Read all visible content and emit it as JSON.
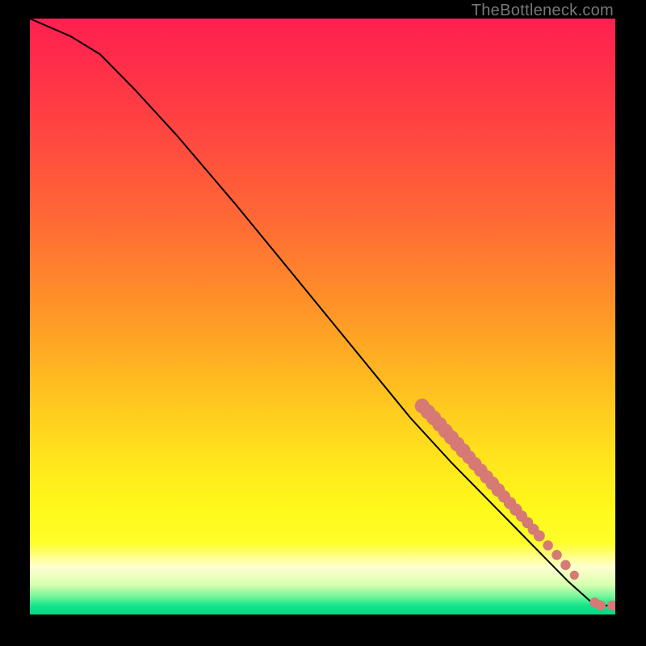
{
  "watermark": "TheBottleneck.com",
  "colors": {
    "marker": "#d77a76",
    "curve": "#000000"
  },
  "chart_data": {
    "type": "line",
    "title": "",
    "xlabel": "",
    "ylabel": "",
    "xlim": [
      0,
      100
    ],
    "ylim": [
      0,
      100
    ],
    "grid": false,
    "gradient": {
      "top": "#ff2050",
      "bottom": "#00d884",
      "description": "red→orange→yellow→pale→green vertical gradient"
    },
    "curve": [
      {
        "x": 0,
        "y": 100
      },
      {
        "x": 7,
        "y": 97
      },
      {
        "x": 12,
        "y": 94
      },
      {
        "x": 18,
        "y": 88
      },
      {
        "x": 25,
        "y": 80.5
      },
      {
        "x": 35,
        "y": 69
      },
      {
        "x": 45,
        "y": 57
      },
      {
        "x": 55,
        "y": 45
      },
      {
        "x": 65,
        "y": 33
      },
      {
        "x": 72,
        "y": 25.5
      },
      {
        "x": 78,
        "y": 19.5
      },
      {
        "x": 83,
        "y": 14.5
      },
      {
        "x": 88,
        "y": 9.5
      },
      {
        "x": 92,
        "y": 5.5
      },
      {
        "x": 96,
        "y": 2.0
      },
      {
        "x": 97.5,
        "y": 1.5
      },
      {
        "x": 99.5,
        "y": 1.5
      }
    ],
    "markers": [
      {
        "x": 67,
        "y": 35.0,
        "r": 1.3
      },
      {
        "x": 68,
        "y": 34.0,
        "r": 1.3
      },
      {
        "x": 69,
        "y": 33.0,
        "r": 1.3
      },
      {
        "x": 70,
        "y": 31.9,
        "r": 1.3
      },
      {
        "x": 71,
        "y": 30.8,
        "r": 1.3
      },
      {
        "x": 72,
        "y": 29.7,
        "r": 1.3
      },
      {
        "x": 73,
        "y": 28.6,
        "r": 1.3
      },
      {
        "x": 74,
        "y": 27.5,
        "r": 1.3
      },
      {
        "x": 75,
        "y": 26.4,
        "r": 1.2
      },
      {
        "x": 76,
        "y": 25.3,
        "r": 1.2
      },
      {
        "x": 77,
        "y": 24.2,
        "r": 1.2
      },
      {
        "x": 78,
        "y": 23.1,
        "r": 1.2
      },
      {
        "x": 79,
        "y": 22.0,
        "r": 1.2
      },
      {
        "x": 80,
        "y": 20.9,
        "r": 1.2
      },
      {
        "x": 81,
        "y": 19.8,
        "r": 1.1
      },
      {
        "x": 82,
        "y": 18.7,
        "r": 1.1
      },
      {
        "x": 83,
        "y": 17.6,
        "r": 1.1
      },
      {
        "x": 84,
        "y": 16.5,
        "r": 1.0
      },
      {
        "x": 85,
        "y": 15.4,
        "r": 1.0
      },
      {
        "x": 86,
        "y": 14.3,
        "r": 1.0
      },
      {
        "x": 87,
        "y": 13.2,
        "r": 1.0
      },
      {
        "x": 88.5,
        "y": 11.6,
        "r": 0.9
      },
      {
        "x": 90,
        "y": 10.0,
        "r": 0.9
      },
      {
        "x": 91.5,
        "y": 8.3,
        "r": 0.9
      },
      {
        "x": 93,
        "y": 6.6,
        "r": 0.8
      },
      {
        "x": 96.5,
        "y": 2.0,
        "r": 0.9
      },
      {
        "x": 97.5,
        "y": 1.5,
        "r": 0.9
      },
      {
        "x": 99.5,
        "y": 1.5,
        "r": 0.9
      }
    ]
  }
}
